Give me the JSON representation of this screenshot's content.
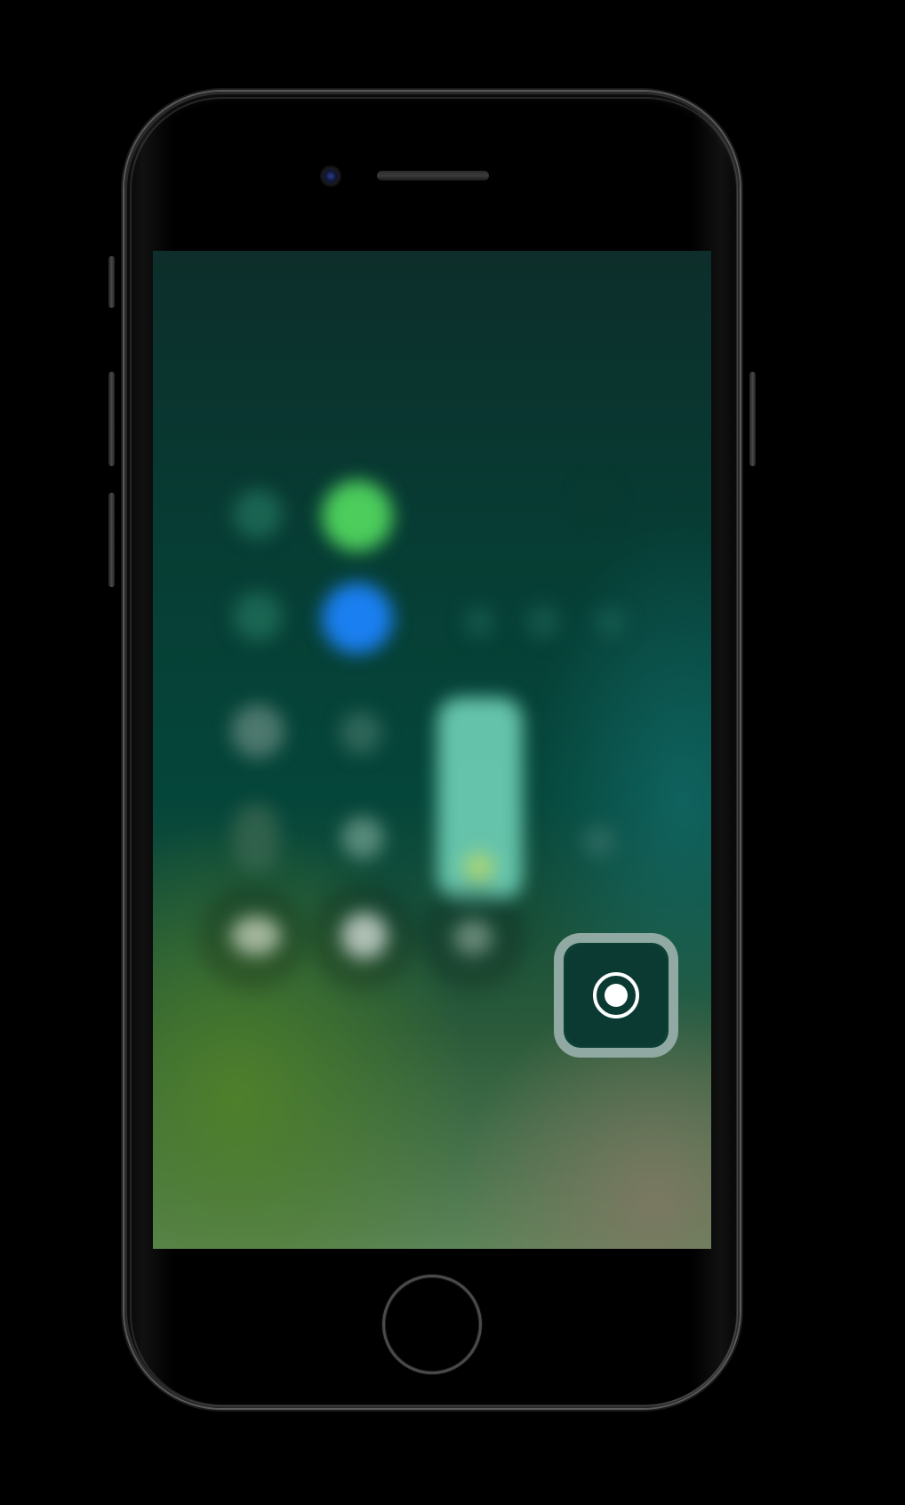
{
  "device": {
    "model_label": "",
    "colors": {
      "body": "#000000",
      "rim": "#5a5a5a",
      "record_outline": "#becdc8",
      "record_icon": "#ffffff"
    }
  },
  "control_center": {
    "state": "blurred",
    "highlighted_control": {
      "name": "screen-recording",
      "icon": "record-icon",
      "label": ""
    },
    "blurred_controls": [
      {
        "name": "airplane-mode",
        "icon": "airplane-icon",
        "color": "#1f6e5a"
      },
      {
        "name": "cellular-data",
        "icon": "antenna-icon",
        "color": "#4ccd5c"
      },
      {
        "name": "wifi",
        "icon": "wifi-icon",
        "color": "#1f6e5a"
      },
      {
        "name": "bluetooth",
        "icon": "bluetooth-icon",
        "color": "#1a7ff0"
      },
      {
        "name": "music-prev",
        "icon": "rewind-icon",
        "color": "#1a5f52"
      },
      {
        "name": "music-play",
        "icon": "play-icon",
        "color": "#1a5f52"
      },
      {
        "name": "music-next",
        "icon": "forward-icon",
        "color": "#1a5f52"
      },
      {
        "name": "rotation-lock",
        "icon": "lock-rotation-icon",
        "color": "#6b8e84"
      },
      {
        "name": "do-not-disturb",
        "icon": "moon-icon",
        "color": "#3f7466"
      },
      {
        "name": "brightness-slider",
        "icon": "sun-icon",
        "color": "#6fd0b7",
        "level": 1.0
      },
      {
        "name": "screen-mirroring",
        "icon": "airplay-icon",
        "color": "#2b6e62"
      },
      {
        "name": "flashlight",
        "icon": "flashlight-icon",
        "color": "#6a8a6a"
      },
      {
        "name": "timer",
        "icon": "timer-icon",
        "color": "#7a9a88"
      },
      {
        "name": "calculator",
        "icon": "calculator-icon",
        "color": "#c0ccc0"
      },
      {
        "name": "camera",
        "icon": "camera-icon",
        "color": "#c8d4cc"
      },
      {
        "name": "volume-slider",
        "icon": "speaker-icon",
        "color": "#4f7a6a"
      }
    ]
  }
}
